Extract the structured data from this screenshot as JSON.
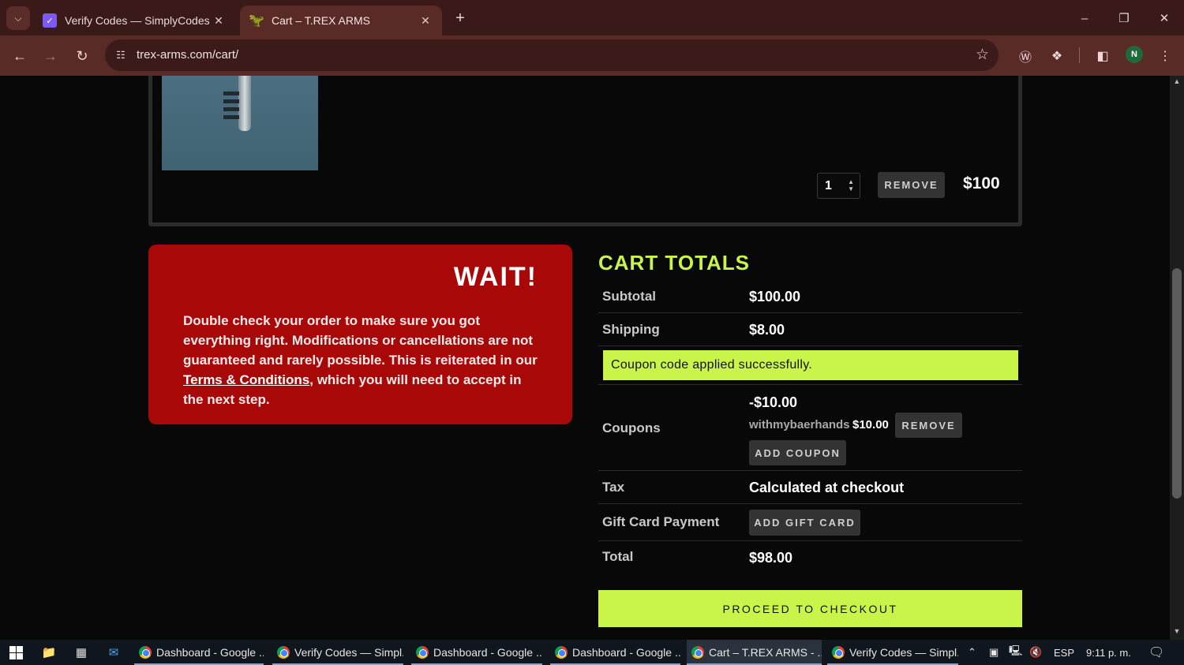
{
  "browser": {
    "tabs": [
      {
        "title": "Verify Codes — SimplyCodes",
        "favicon": "simplycodes-icon",
        "active": false
      },
      {
        "title": "Cart – T.REX ARMS",
        "favicon": "trex-icon",
        "active": true
      }
    ],
    "url": "trex-arms.com/cart/",
    "profile_initial": "N"
  },
  "cart_item": {
    "quantity": "1",
    "remove_label": "REMOVE",
    "price": "$100"
  },
  "wait_notice": {
    "title": "WAIT!",
    "text_before_link": "Double check your order to make sure you got everything right. Modifications or cancellations are not guaranteed and rarely possible. This is reiterated in our ",
    "link_text": "Terms & Conditions",
    "text_after_link": ", which you will need to accept in the next step."
  },
  "cart_totals": {
    "title": "CART TOTALS",
    "subtotal_label": "Subtotal",
    "subtotal_value": "$100.00",
    "shipping_label": "Shipping",
    "shipping_value": "$8.00",
    "coupon_message": "Coupon code applied successfully.",
    "coupons_label": "Coupons",
    "coupons_discount": "-$10.00",
    "coupon_code": "withmybaerhands",
    "coupon_amount": "$10.00",
    "coupon_remove_label": "REMOVE",
    "add_coupon_label": "ADD COUPON",
    "tax_label": "Tax",
    "tax_value": "Calculated at checkout",
    "gift_card_label": "Gift Card Payment",
    "add_gift_card_label": "ADD GIFT CARD",
    "total_label": "Total",
    "total_value": "$98.00",
    "checkout_label": "PROCEED TO CHECKOUT"
  },
  "taskbar": {
    "apps": [
      {
        "title": "Dashboard - Google ..."
      },
      {
        "title": "Verify Codes — Simpl..."
      },
      {
        "title": "Dashboard - Google ..."
      },
      {
        "title": "Dashboard - Google ..."
      },
      {
        "title": "Cart – T.REX ARMS - ..."
      },
      {
        "title": "Verify Codes — Simpl..."
      }
    ],
    "language": "ESP",
    "time": "9:11 p. m."
  },
  "colors": {
    "accent": "#c9f44a",
    "warning_bg": "#a80808",
    "chrome_frame": "#3a1a19",
    "chrome_toolbar": "#5a2a27"
  }
}
